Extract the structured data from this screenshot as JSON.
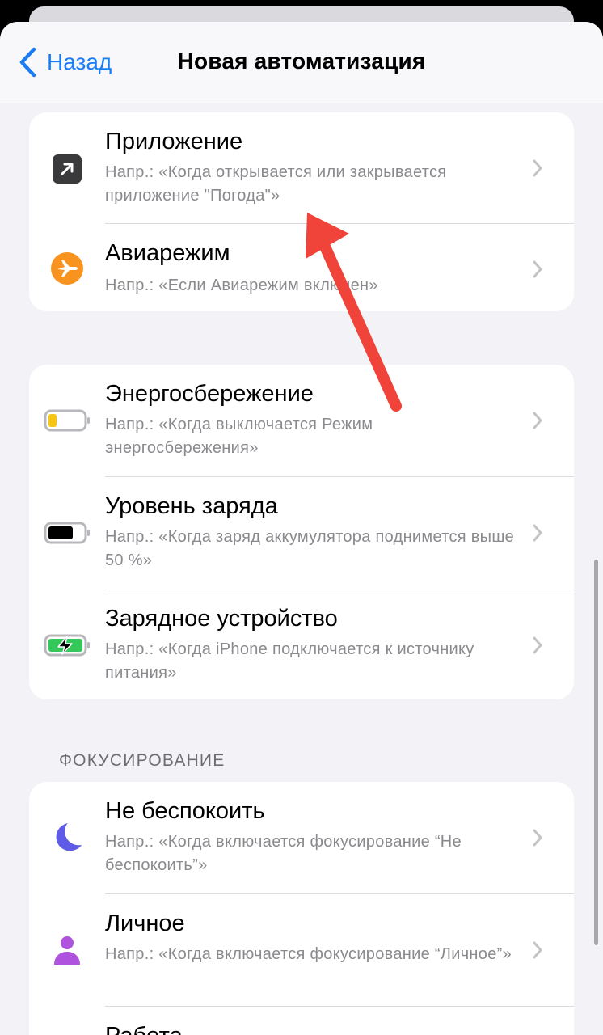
{
  "nav": {
    "back_label": "Назад",
    "title": "Новая автоматизация"
  },
  "groups": [
    {
      "rows": [
        {
          "title": "Приложение",
          "subtitle": "Напр.: «Когда открывается или закрывается приложение \"Погода\"»",
          "icon": "app-arrow-icon"
        },
        {
          "title": "Авиарежим",
          "subtitle": "Напр.: «Если Авиарежим включен»",
          "icon": "airplane-icon"
        }
      ]
    },
    {
      "rows": [
        {
          "title": "Энергосбережение",
          "subtitle": "Напр.: «Когда выключается Режим энергосбережения»",
          "icon": "low-battery-icon"
        },
        {
          "title": "Уровень заряда",
          "subtitle": "Напр.: «Когда заряд аккумулятора поднимется выше 50 %»",
          "icon": "battery-full-icon"
        },
        {
          "title": "Зарядное устройство",
          "subtitle": "Напр.: «Когда iPhone подключается к источнику питания»",
          "icon": "battery-charging-icon"
        }
      ]
    },
    {
      "header": "ФОКУСИРОВАНИЕ",
      "rows": [
        {
          "title": "Не беспокоить",
          "subtitle": "Напр.: «Когда включается фокусирование “Не беспокоить”»",
          "icon": "moon-icon"
        },
        {
          "title": "Личное",
          "subtitle": "Напр.: «Когда включается фокусирование “Личное”»",
          "icon": "person-icon"
        },
        {
          "title": "Работа",
          "subtitle": "",
          "icon": "work-icon"
        }
      ]
    }
  ],
  "colors": {
    "accent": "#1a7cf5",
    "airplane": "#f7931e",
    "low_battery": "#f5c518",
    "charging": "#34c759",
    "moon": "#5e5ce6",
    "person": "#af52de",
    "annotation_arrow": "#f0433a"
  }
}
